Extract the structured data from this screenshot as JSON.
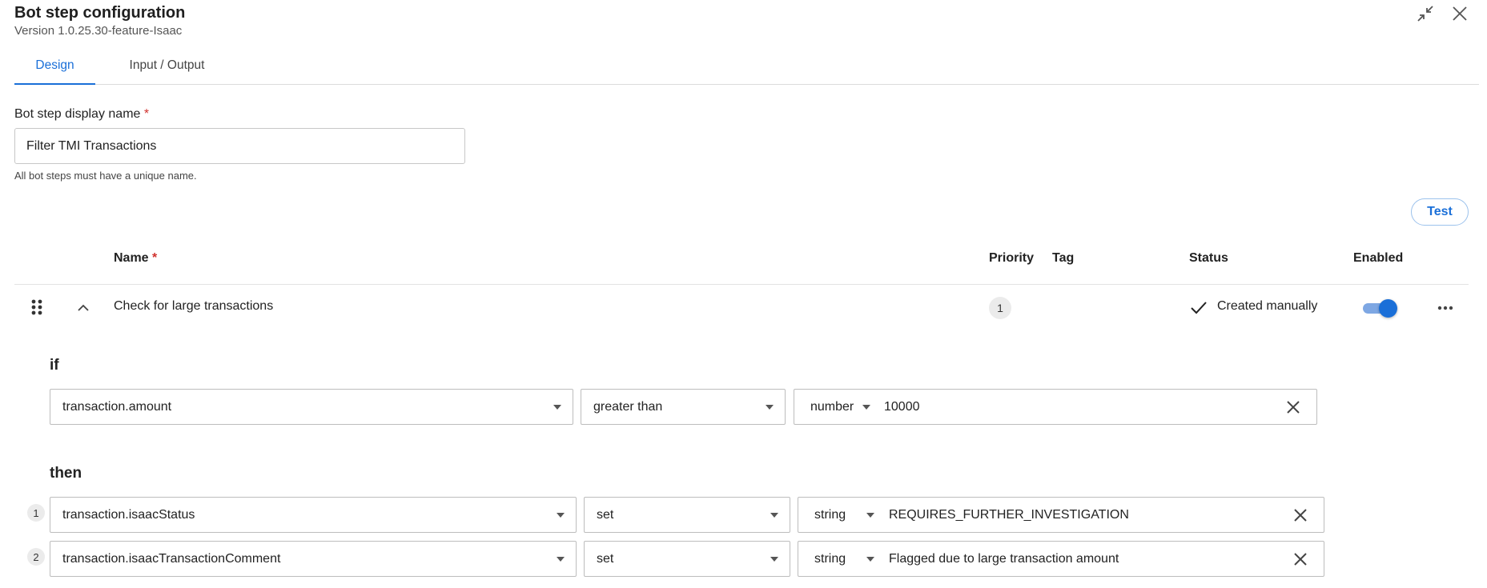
{
  "header": {
    "title": "Bot step configuration",
    "version": "Version 1.0.25.30-feature-Isaac"
  },
  "tabs": [
    {
      "label": "Design",
      "active": true
    },
    {
      "label": "Input / Output",
      "active": false
    }
  ],
  "form": {
    "display_name_label": "Bot step display name",
    "required_mark": "*",
    "display_name_value": "Filter TMI Transactions",
    "hint": "All bot steps must have a unique name."
  },
  "actions": {
    "test_label": "Test"
  },
  "table": {
    "columns": {
      "name": "Name",
      "name_required": "*",
      "priority": "Priority",
      "tag": "Tag",
      "status": "Status",
      "enabled": "Enabled"
    },
    "rule": {
      "name": "Check for large transactions",
      "priority": "1",
      "tag": "",
      "status": "Created manually",
      "enabled": true
    }
  },
  "condition": {
    "if_label": "if",
    "field": "transaction.amount",
    "operator": "greater than",
    "value_type": "number",
    "value": "10000"
  },
  "then": {
    "label": "then",
    "actions": [
      {
        "index": "1",
        "field": "transaction.isaacStatus",
        "operation": "set",
        "value_type": "string",
        "value": "REQUIRES_FURTHER_INVESTIGATION"
      },
      {
        "index": "2",
        "field": "transaction.isaacTransactionComment",
        "operation": "set",
        "value_type": "string",
        "value": "Flagged due to large transaction amount"
      }
    ]
  },
  "colors": {
    "accent": "#1a6fd8",
    "required": "#d0312d"
  }
}
